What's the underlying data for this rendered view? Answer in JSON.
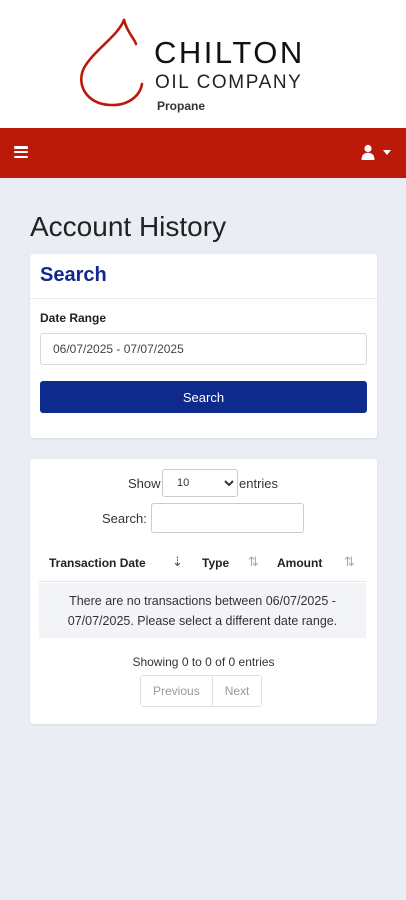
{
  "brand": {
    "name": "CHILTON",
    "subtitle": "OIL COMPANY",
    "tagline": "Propane",
    "accent_color": "#bb1a0a",
    "primary_color": "#0e2a8d"
  },
  "navbar": {
    "menu_icon": "hamburger-icon",
    "user_icon": "user-icon"
  },
  "page": {
    "title": "Account History"
  },
  "search_card": {
    "header": "Search",
    "date_label": "Date Range",
    "date_value": "06/07/2025 - 07/07/2025",
    "button_label": "Search"
  },
  "table": {
    "show_label": "Show",
    "entries_label": "entries",
    "page_size": "10",
    "page_size_options": [
      "10"
    ],
    "search_label": "Search:",
    "search_value": "",
    "columns": [
      "Transaction Date",
      "Type",
      "Amount"
    ],
    "empty_message": "There are no transactions between 06/07/2025 - 07/07/2025. Please select a different date range.",
    "info": "Showing 0 to 0 of 0 entries",
    "previous_label": "Previous",
    "next_label": "Next"
  }
}
